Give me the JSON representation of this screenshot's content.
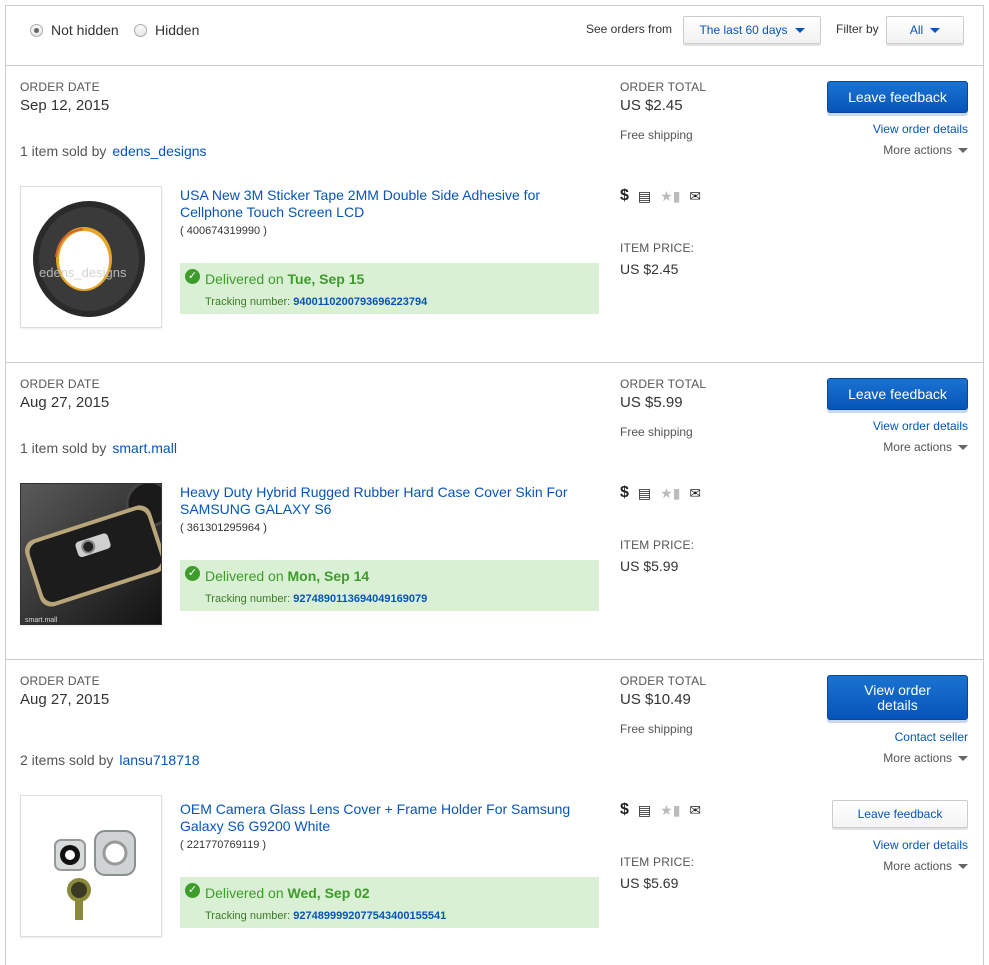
{
  "filters": {
    "radio_not_hidden": "Not hidden",
    "radio_hidden": "Hidden",
    "see_orders_label": "See orders from",
    "period_value": "The last 60 days",
    "filter_by_label": "Filter by",
    "filter_value": "All"
  },
  "labels": {
    "order_date": "ORDER DATE",
    "order_total": "ORDER TOTAL",
    "item_price": "ITEM PRICE:",
    "free_shipping": "Free shipping",
    "sold_by_1": "1 item sold by",
    "sold_by_2": "2 items sold by",
    "delivered_on": "Delivered on",
    "tracking_number": "Tracking number:",
    "leave_feedback": "Leave feedback",
    "view_order_details": "View order details",
    "more_actions": "More actions",
    "contact_seller": "Contact seller"
  },
  "orders": [
    {
      "date": "Sep 12, 2015",
      "total": "US $2.45",
      "seller": "edens_designs",
      "item_title": "USA New 3M Sticker Tape 2MM Double Side Adhesive for Cellphone Touch Screen LCD",
      "item_id": "( 400674319990 )",
      "delivered_date": "Tue, Sep 15",
      "tracking": "9400110200793696223794",
      "item_price": "US $2.45",
      "thumb_watermark": "edens_designs"
    },
    {
      "date": "Aug 27, 2015",
      "total": "US $5.99",
      "seller": "smart.mall",
      "item_title": "Heavy Duty Hybrid Rugged Rubber Hard Case Cover Skin For SAMSUNG GALAXY S6",
      "item_id": "( 361301295964 )",
      "delivered_date": "Mon, Sep 14",
      "tracking": "9274890113694049169079",
      "item_price": "US $5.99",
      "thumb_watermark": "smart.mall"
    },
    {
      "date": "Aug 27, 2015",
      "total": "US $10.49",
      "seller": "lansu718718",
      "item_title": "OEM Camera Glass Lens Cover + Frame Holder For Samsung Galaxy S6 G9200 White",
      "item_id": "( 221770769119 )",
      "delivered_date": "Wed, Sep 02",
      "tracking": "9274899992077543400155541",
      "item_price": "US $5.69",
      "view_details_line1": "View order",
      "view_details_line2": "details"
    }
  ],
  "icons": {
    "dollar": "$",
    "package": "package-icon",
    "shipped": "shipped-icon",
    "feedback": "feedback-envelope-icon"
  },
  "colors": {
    "link": "#0654ba",
    "button": "#0654ba",
    "delivered_bg": "#d9f0d4",
    "delivered_text": "#3d9c2a"
  }
}
